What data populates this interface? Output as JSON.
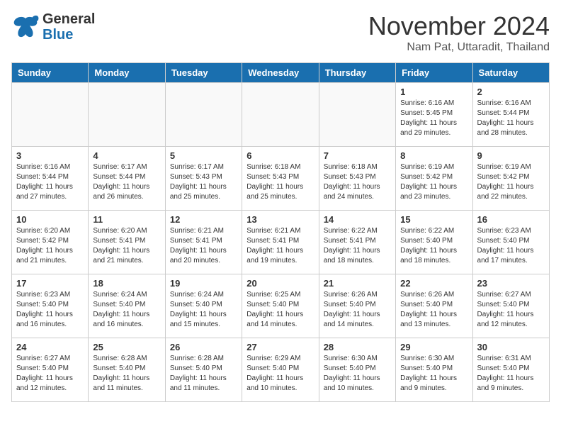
{
  "logo": {
    "line1": "General",
    "line2": "Blue"
  },
  "title": "November 2024",
  "location": "Nam Pat, Uttaradit, Thailand",
  "days_header": [
    "Sunday",
    "Monday",
    "Tuesday",
    "Wednesday",
    "Thursday",
    "Friday",
    "Saturday"
  ],
  "weeks": [
    [
      {
        "day": "",
        "empty": true
      },
      {
        "day": "",
        "empty": true
      },
      {
        "day": "",
        "empty": true
      },
      {
        "day": "",
        "empty": true
      },
      {
        "day": "",
        "empty": true
      },
      {
        "day": "1",
        "sunrise": "6:16 AM",
        "sunset": "5:45 PM",
        "daylight": "11 hours and 29 minutes."
      },
      {
        "day": "2",
        "sunrise": "6:16 AM",
        "sunset": "5:44 PM",
        "daylight": "11 hours and 28 minutes."
      }
    ],
    [
      {
        "day": "3",
        "sunrise": "6:16 AM",
        "sunset": "5:44 PM",
        "daylight": "11 hours and 27 minutes."
      },
      {
        "day": "4",
        "sunrise": "6:17 AM",
        "sunset": "5:44 PM",
        "daylight": "11 hours and 26 minutes."
      },
      {
        "day": "5",
        "sunrise": "6:17 AM",
        "sunset": "5:43 PM",
        "daylight": "11 hours and 25 minutes."
      },
      {
        "day": "6",
        "sunrise": "6:18 AM",
        "sunset": "5:43 PM",
        "daylight": "11 hours and 25 minutes."
      },
      {
        "day": "7",
        "sunrise": "6:18 AM",
        "sunset": "5:43 PM",
        "daylight": "11 hours and 24 minutes."
      },
      {
        "day": "8",
        "sunrise": "6:19 AM",
        "sunset": "5:42 PM",
        "daylight": "11 hours and 23 minutes."
      },
      {
        "day": "9",
        "sunrise": "6:19 AM",
        "sunset": "5:42 PM",
        "daylight": "11 hours and 22 minutes."
      }
    ],
    [
      {
        "day": "10",
        "sunrise": "6:20 AM",
        "sunset": "5:42 PM",
        "daylight": "11 hours and 21 minutes."
      },
      {
        "day": "11",
        "sunrise": "6:20 AM",
        "sunset": "5:41 PM",
        "daylight": "11 hours and 21 minutes."
      },
      {
        "day": "12",
        "sunrise": "6:21 AM",
        "sunset": "5:41 PM",
        "daylight": "11 hours and 20 minutes."
      },
      {
        "day": "13",
        "sunrise": "6:21 AM",
        "sunset": "5:41 PM",
        "daylight": "11 hours and 19 minutes."
      },
      {
        "day": "14",
        "sunrise": "6:22 AM",
        "sunset": "5:41 PM",
        "daylight": "11 hours and 18 minutes."
      },
      {
        "day": "15",
        "sunrise": "6:22 AM",
        "sunset": "5:40 PM",
        "daylight": "11 hours and 18 minutes."
      },
      {
        "day": "16",
        "sunrise": "6:23 AM",
        "sunset": "5:40 PM",
        "daylight": "11 hours and 17 minutes."
      }
    ],
    [
      {
        "day": "17",
        "sunrise": "6:23 AM",
        "sunset": "5:40 PM",
        "daylight": "11 hours and 16 minutes."
      },
      {
        "day": "18",
        "sunrise": "6:24 AM",
        "sunset": "5:40 PM",
        "daylight": "11 hours and 16 minutes."
      },
      {
        "day": "19",
        "sunrise": "6:24 AM",
        "sunset": "5:40 PM",
        "daylight": "11 hours and 15 minutes."
      },
      {
        "day": "20",
        "sunrise": "6:25 AM",
        "sunset": "5:40 PM",
        "daylight": "11 hours and 14 minutes."
      },
      {
        "day": "21",
        "sunrise": "6:26 AM",
        "sunset": "5:40 PM",
        "daylight": "11 hours and 14 minutes."
      },
      {
        "day": "22",
        "sunrise": "6:26 AM",
        "sunset": "5:40 PM",
        "daylight": "11 hours and 13 minutes."
      },
      {
        "day": "23",
        "sunrise": "6:27 AM",
        "sunset": "5:40 PM",
        "daylight": "11 hours and 12 minutes."
      }
    ],
    [
      {
        "day": "24",
        "sunrise": "6:27 AM",
        "sunset": "5:40 PM",
        "daylight": "11 hours and 12 minutes."
      },
      {
        "day": "25",
        "sunrise": "6:28 AM",
        "sunset": "5:40 PM",
        "daylight": "11 hours and 11 minutes."
      },
      {
        "day": "26",
        "sunrise": "6:28 AM",
        "sunset": "5:40 PM",
        "daylight": "11 hours and 11 minutes."
      },
      {
        "day": "27",
        "sunrise": "6:29 AM",
        "sunset": "5:40 PM",
        "daylight": "11 hours and 10 minutes."
      },
      {
        "day": "28",
        "sunrise": "6:30 AM",
        "sunset": "5:40 PM",
        "daylight": "11 hours and 10 minutes."
      },
      {
        "day": "29",
        "sunrise": "6:30 AM",
        "sunset": "5:40 PM",
        "daylight": "11 hours and 9 minutes."
      },
      {
        "day": "30",
        "sunrise": "6:31 AM",
        "sunset": "5:40 PM",
        "daylight": "11 hours and 9 minutes."
      }
    ]
  ]
}
